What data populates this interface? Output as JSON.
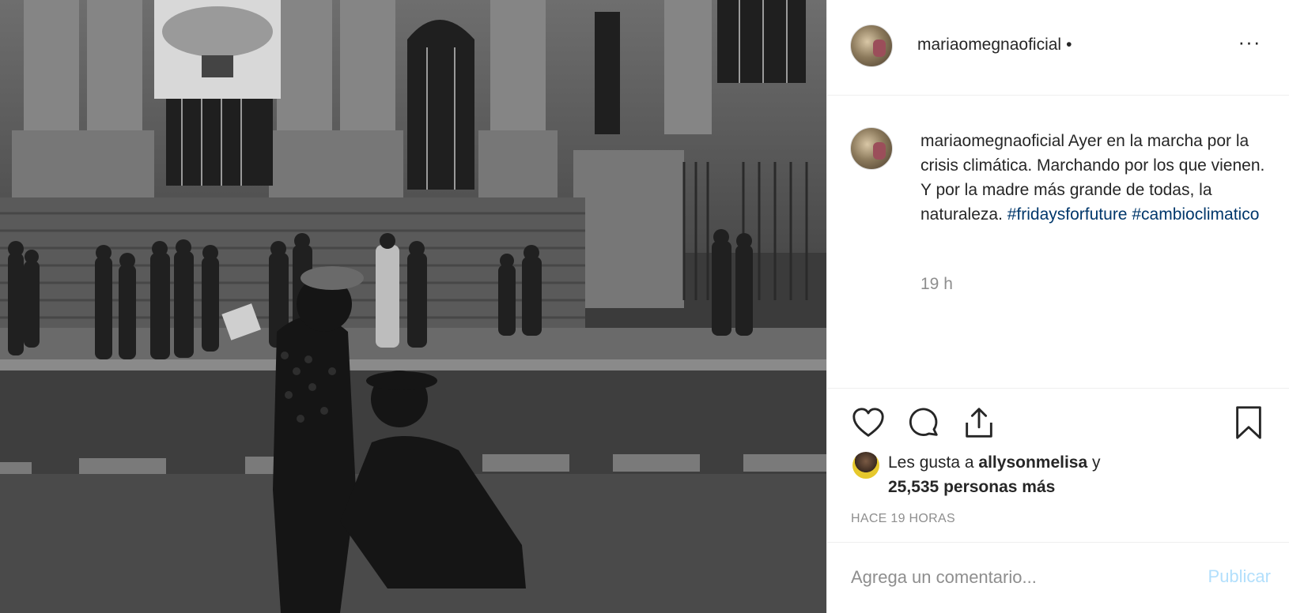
{
  "post": {
    "username": "mariaomegnaoficial",
    "header_dot": "•",
    "more_icon": "ellipsis-icon",
    "photo_alt": "Ayer en la marcha por la crisis climática",
    "caption_username": "mariaomegnaoficial",
    "caption_text": "Ayer en la marcha por la crisis climática. Marchando por los que vienen. Y por la madre más grande de todas, la naturaleza.",
    "hashtags": [
      "#fridaysforfuture",
      "#cambioclimatico"
    ],
    "time_ago": "19 h"
  },
  "actions": {
    "like_icon": "heart-icon",
    "comment_icon": "comment-icon",
    "share_icon": "share-icon",
    "save_icon": "bookmark-icon"
  },
  "likes": {
    "prefix": "Les gusta a ",
    "liker": "allysonmelisa",
    "conjunction": " y",
    "count_text": "25,535 personas más"
  },
  "timestamp": "HACE 19 HORAS",
  "comment": {
    "placeholder": "Agrega un comentario...",
    "publish_label": "Publicar"
  }
}
